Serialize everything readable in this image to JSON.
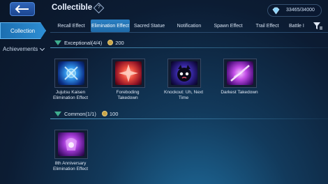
{
  "header": {
    "title": "Collectible",
    "help_symbol": "?",
    "currency_amount": "33465/34000",
    "currency_icon": "diamond-icon"
  },
  "sidebar": {
    "collection_label": "Collection",
    "achievements_label": "Achievements"
  },
  "tabs": [
    {
      "label": "Recall Effect",
      "active": false
    },
    {
      "label": "Elimination Effect",
      "active": true
    },
    {
      "label": "Sacred Statue",
      "active": false
    },
    {
      "label": "Notification",
      "active": false
    },
    {
      "label": "Spawn Effect",
      "active": false
    },
    {
      "label": "Trail Effect",
      "active": false
    },
    {
      "label": "Battle I",
      "active": false
    }
  ],
  "sections": [
    {
      "title": "Exceptional(4/4)",
      "points": "200",
      "items": [
        {
          "label": "Jujutsu Kaisen Elimination Effect",
          "icon": "jujutsu-effect-icon"
        },
        {
          "label": "Foreboding Takedown",
          "icon": "foreboding-effect-icon"
        },
        {
          "label": "Knockout: Uh, Next Time",
          "icon": "knockout-effect-icon"
        },
        {
          "label": "Darkest Takedown",
          "icon": "darkest-effect-icon"
        }
      ]
    },
    {
      "title": "Common(1/1)",
      "points": "100",
      "items": [
        {
          "label": "8th Anniversary Elimination Effect",
          "icon": "anniversary-effect-icon"
        }
      ]
    }
  ],
  "colors": {
    "accent": "#2a7fc2",
    "section_marker": "#3fae8e",
    "coin": "#c9a548"
  }
}
